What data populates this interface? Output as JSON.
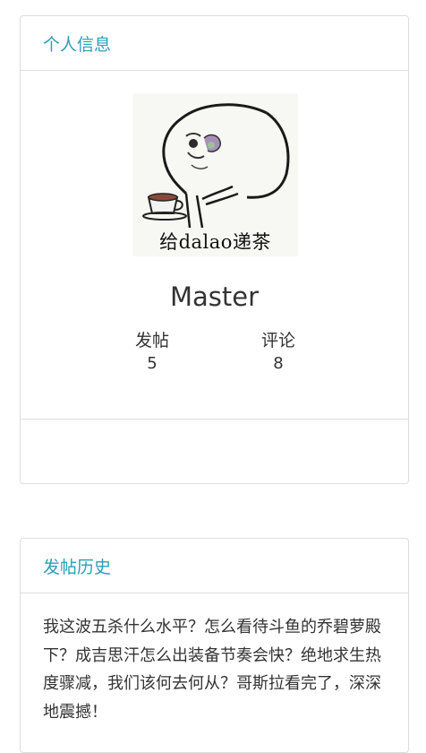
{
  "profile_card": {
    "title": "个人信息",
    "avatar_caption": "给dalao递茶",
    "username": "Master",
    "stats": [
      {
        "label": "发帖",
        "value": "5"
      },
      {
        "label": "评论",
        "value": "8"
      }
    ]
  },
  "history_card": {
    "title": "发帖历史",
    "post_text": "我这波五杀什么水平？怎么看待斗鱼的乔碧萝殿下？成吉思汗怎么出装备节奏会快？绝地求生热度骤减，我们该何去何从？哥斯拉看完了，深深地震撼！"
  },
  "colors": {
    "accent": "#2a9fb5",
    "border": "#dddddd",
    "text": "#333333"
  }
}
